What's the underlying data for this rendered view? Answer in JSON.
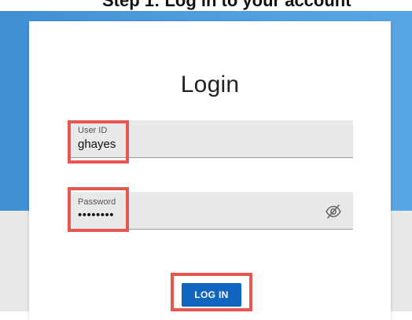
{
  "page": {
    "top_caption": "Step 1: Log in to your account"
  },
  "login": {
    "title": "Login",
    "user_id": {
      "label": "User ID",
      "value": "ghayes"
    },
    "password": {
      "label": "Password",
      "value": "••••••••",
      "toggle_icon": "eye-slash-icon"
    },
    "submit_label": "LOG IN"
  },
  "colors": {
    "background_blue": "#4f9fe0",
    "button": "#0f65bf",
    "highlight": "#e8574f",
    "field_bg": "#e9e9e9"
  }
}
